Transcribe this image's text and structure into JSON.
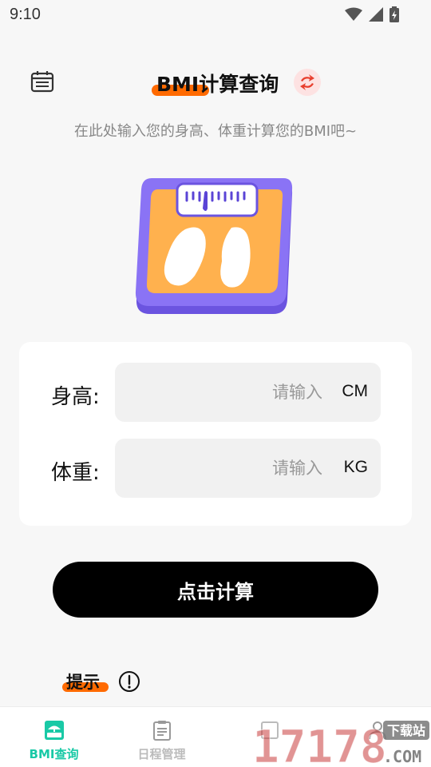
{
  "status_bar": {
    "time": "9:10",
    "icons": [
      "wifi-icon",
      "signal-icon",
      "battery-icon"
    ]
  },
  "header": {
    "title": "BMI计算查询",
    "subtitle": "在此处输入您的身高、体重计算您的BMI吧~",
    "left_icon": "calendar-icon",
    "right_icon": "refresh-icon"
  },
  "form": {
    "height": {
      "label": "身高:",
      "placeholder": "请输入",
      "unit": "CM",
      "value": ""
    },
    "weight": {
      "label": "体重:",
      "placeholder": "请输入",
      "unit": "KG",
      "value": ""
    }
  },
  "calculate_button": "点击计算",
  "tips": {
    "label": "提示",
    "icon": "info-icon"
  },
  "bottom_nav": {
    "items": [
      {
        "label": "BMI查询",
        "icon": "bmi-icon",
        "active": true
      },
      {
        "label": "日程管理",
        "icon": "checklist-icon",
        "active": false
      },
      {
        "label": "",
        "icon": "book-icon",
        "active": false
      },
      {
        "label": "",
        "icon": "profile-icon",
        "active": false
      }
    ]
  },
  "watermark": {
    "text": "17178",
    "suffix": ".COM",
    "tag": "下载站"
  },
  "colors": {
    "accent_orange": "#ff6a00",
    "accent_green": "#19c9a6",
    "button_black": "#000000",
    "scale_purple": "#8a73f5",
    "scale_orange": "#ffb14e"
  }
}
